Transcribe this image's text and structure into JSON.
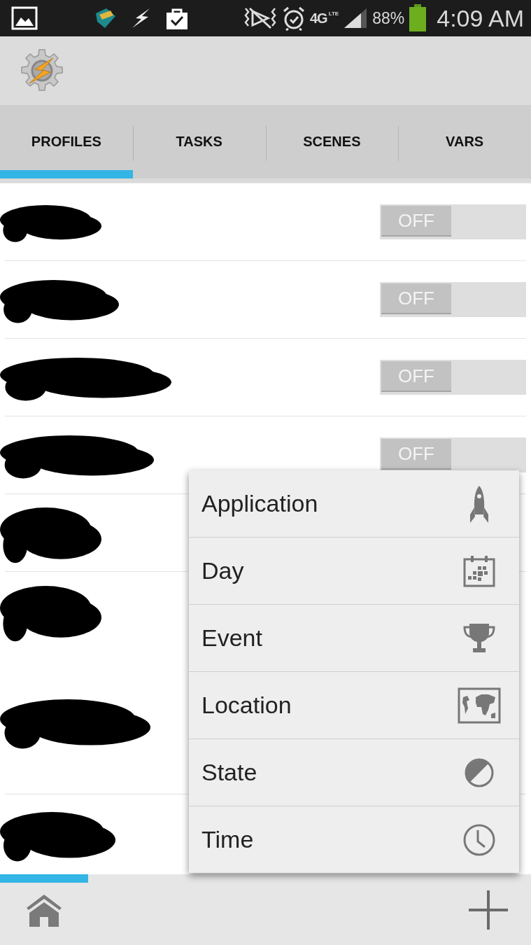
{
  "status_bar": {
    "network": "4G",
    "network_sub": "LTE",
    "battery": "88%",
    "time": "4:09 AM"
  },
  "tabs": [
    {
      "label": "PROFILES",
      "selected": true
    },
    {
      "label": "TASKS",
      "selected": false
    },
    {
      "label": "SCENES",
      "selected": false
    },
    {
      "label": "VARS",
      "selected": false
    }
  ],
  "profiles": [
    {
      "redacted": true,
      "toggle": {
        "label": "OFF",
        "on": false
      }
    },
    {
      "redacted": true,
      "toggle": {
        "label": "OFF",
        "on": false
      }
    },
    {
      "redacted": true,
      "toggle": {
        "label": "OFF",
        "on": false
      }
    },
    {
      "redacted": true,
      "toggle": {
        "label": "OFF",
        "on": false
      }
    },
    {
      "redacted": true
    },
    {
      "redacted": true
    },
    {
      "redacted": true
    },
    {
      "redacted": true
    }
  ],
  "context_menu": {
    "items": [
      {
        "label": "Application",
        "kind": "rocket"
      },
      {
        "label": "Day",
        "kind": "calendar"
      },
      {
        "label": "Event",
        "kind": "trophy"
      },
      {
        "label": "Location",
        "kind": "map"
      },
      {
        "label": "State",
        "kind": "contrast"
      },
      {
        "label": "Time",
        "kind": "clock"
      }
    ]
  }
}
